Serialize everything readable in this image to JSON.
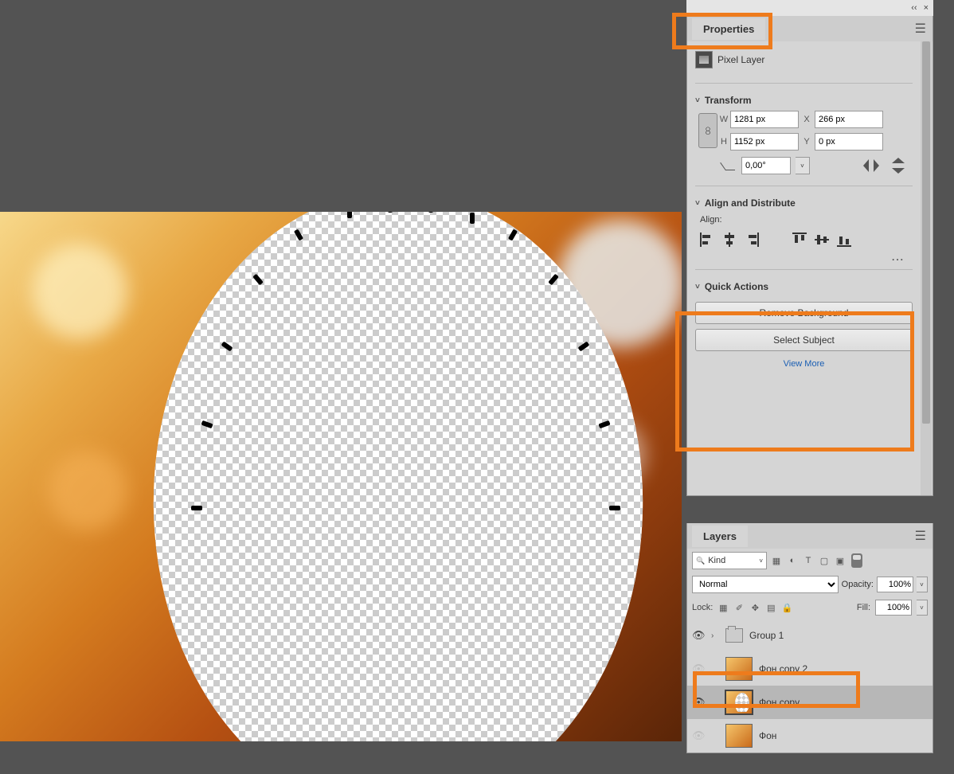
{
  "topstrip": {
    "collapse_glyph": "‹‹",
    "close_glyph": "×"
  },
  "properties": {
    "tab_label": "Properties",
    "layer_type_label": "Pixel Layer",
    "transform": {
      "title": "Transform",
      "W_label": "W",
      "W_value": "1281 px",
      "H_label": "H",
      "H_value": "1152 px",
      "X_label": "X",
      "X_value": "266 px",
      "Y_label": "Y",
      "Y_value": "0 px",
      "rotation_value": "0,00°"
    },
    "align": {
      "title": "Align and Distribute",
      "subtitle": "Align:"
    },
    "quick_actions": {
      "title": "Quick Actions",
      "remove_bg_label": "Remove Background",
      "select_subject_label": "Select Subject",
      "view_more_label": "View More"
    }
  },
  "layers": {
    "tab_label": "Layers",
    "kind_label": "Kind",
    "blend_mode": "Normal",
    "opacity_label": "Opacity:",
    "opacity_value": "100%",
    "lock_label": "Lock:",
    "fill_label": "Fill:",
    "fill_value": "100%",
    "items": [
      {
        "name": "Group 1",
        "visible": true,
        "type": "group"
      },
      {
        "name": "Фон copy 2",
        "visible": false,
        "type": "pixel"
      },
      {
        "name": "Фон copy",
        "visible": true,
        "type": "pixel",
        "selected": true
      },
      {
        "name": "Фон",
        "visible": false,
        "type": "pixel"
      }
    ]
  }
}
